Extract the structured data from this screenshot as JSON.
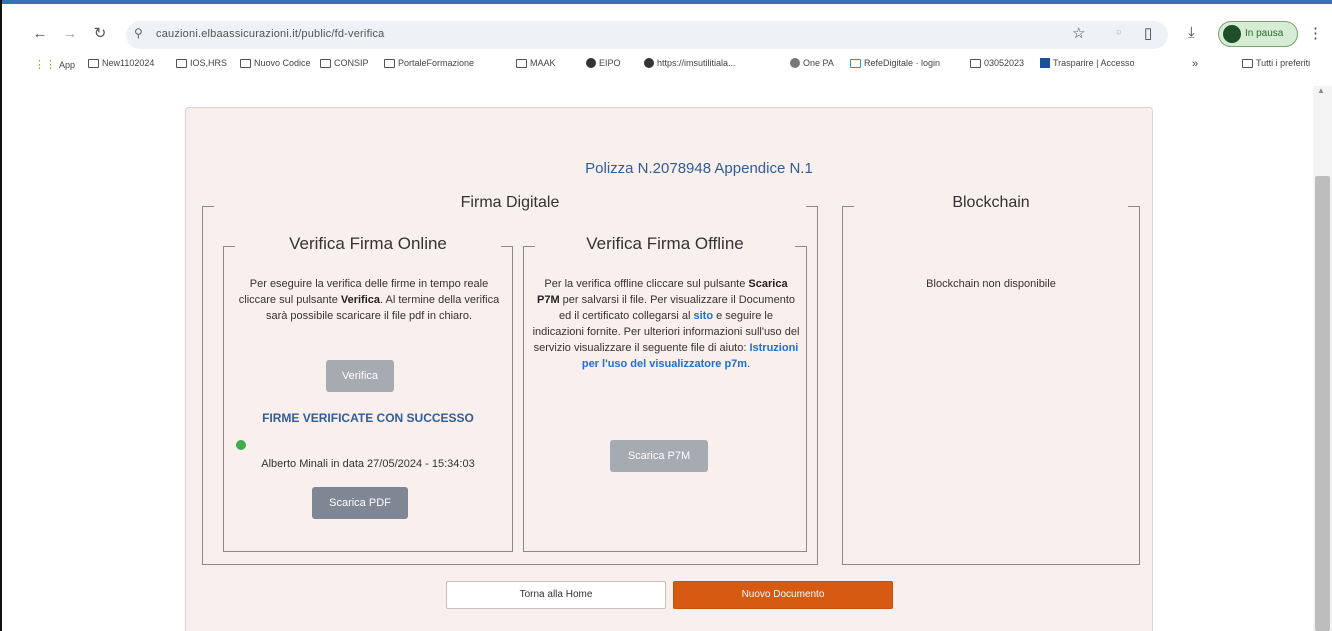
{
  "browser": {
    "url": "cauzioni.elbaassicurazioni.it/public/fd-verifica",
    "profile_label": "In pausa",
    "bookmarks": [
      {
        "icon": "apps-icon",
        "label": "App"
      },
      {
        "icon": "folder-icon",
        "label": "New1102024"
      },
      {
        "icon": "folder-icon",
        "label": "IOS,HRS"
      },
      {
        "icon": "folder-icon",
        "label": "Nuovo Codice"
      },
      {
        "icon": "folder-icon",
        "label": "CONSIP"
      },
      {
        "icon": "folder-icon",
        "label": "PortaleFormazione"
      },
      {
        "icon": "folder-icon",
        "label": "MAAK"
      },
      {
        "icon": "globe-icon",
        "label": "EIPO"
      },
      {
        "icon": "globe-icon",
        "label": "https://imsutilitiala..."
      },
      {
        "icon": "globe-icon",
        "label": "One PA"
      },
      {
        "icon": "doc-icon",
        "label": "RefeDigitale · login"
      },
      {
        "icon": "folder-icon",
        "label": "03052023"
      },
      {
        "icon": "square-icon",
        "label": "Trasparire | Accesso"
      },
      {
        "icon": "folder-icon",
        "label": "Tutti i preferiti"
      }
    ]
  },
  "page": {
    "policy_title": "Polizza N.2078948  Appendice N.1",
    "firma_digitale": {
      "title": "Firma Digitale",
      "online": {
        "title": "Verifica Firma Online",
        "text_1": "Per eseguire la verifica delle firme in tempo reale cliccare sul pulsante ",
        "text_bold": "Verifica",
        "text_2": ". Al termine della verifica sarà possibile scaricare il file pdf in chiaro.",
        "verify_button": "Verifica",
        "success": "FIRME VERIFICATE CON SUCCESSO",
        "signer": "Alberto Minali in data 27/05/2024 - 15:34:03",
        "download_pdf": "Scarica PDF"
      },
      "offline": {
        "title": "Verifica Firma Offline",
        "text_1": "Per la verifica offline cliccare sul pulsante ",
        "text_bold": "Scarica P7M",
        "text_2": " per salvarsi il file. Per visualizzare il Documento ed il certificato collegarsi al ",
        "link_sito": "sito",
        "text_3": " e seguire le indicazioni fornite. Per ulteriori informazioni sull'uso del servizio visualizzare il seguente file di aiuto: ",
        "link_help": "Istruzioni per l'uso del visualizzatore p7m",
        "text_4": ".",
        "download_p7m": "Scarica P7M"
      }
    },
    "blockchain": {
      "title": "Blockchain",
      "status": "Blockchain non disponibile"
    },
    "home_button": "Torna alla Home",
    "new_doc_button": "Nuovo Documento"
  }
}
